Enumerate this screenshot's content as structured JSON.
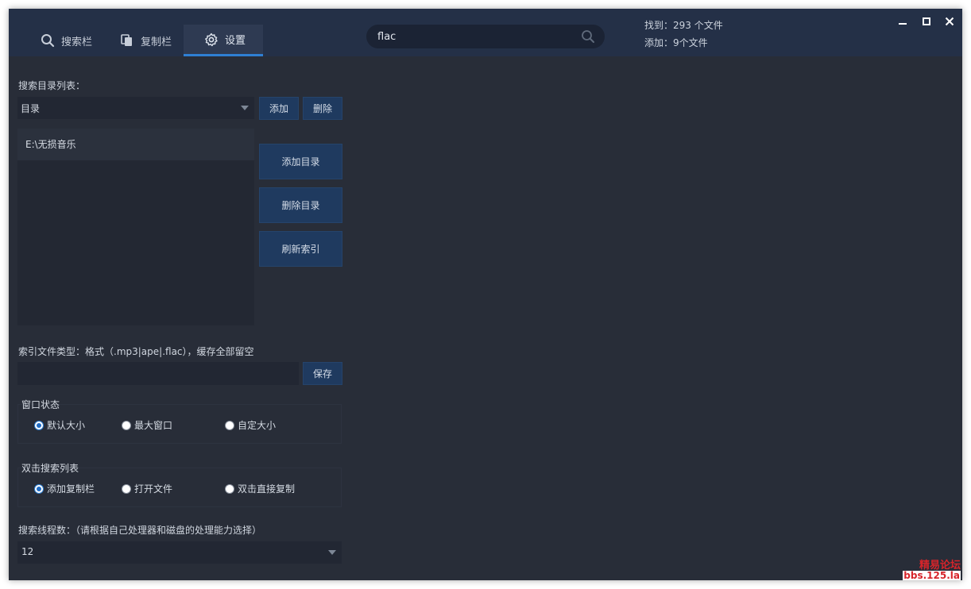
{
  "tabs": [
    {
      "label": "搜索栏",
      "icon": "search-icon"
    },
    {
      "label": "复制栏",
      "icon": "copy-icon"
    },
    {
      "label": "设置",
      "icon": "gear-icon",
      "active": true
    }
  ],
  "search": {
    "value": "flac"
  },
  "stats": {
    "found": "找到：293 个文件",
    "added": "添加：9个文件"
  },
  "window_controls": {
    "minimize": "—",
    "maximize": "▫",
    "close": "✕"
  },
  "dir_section": {
    "label": "搜索目录列表：",
    "select_value": "目录",
    "add_label": "添加",
    "delete_label": "删除",
    "items": [
      "E:\\无损音乐"
    ],
    "add_dir_label": "添加目录",
    "delete_dir_label": "删除目录",
    "refresh_label": "刷新索引"
  },
  "index_section": {
    "label": "索引文件类型：格式（.mp3|ape|.flac），缓存全部留空",
    "input_value": "",
    "save_label": "保存"
  },
  "window_state": {
    "title": "窗口状态",
    "options": [
      "默认大小",
      "最大窗口",
      "自定大小"
    ],
    "selected": 0
  },
  "double_click": {
    "title": "双击搜索列表",
    "options": [
      "添加复制栏",
      "打开文件",
      "双击直接复制"
    ],
    "selected": 0
  },
  "threads": {
    "label": "搜索线程数：（请根据自己处理器和磁盘的处理能力选择）",
    "value": "12"
  },
  "watermark": {
    "line1": "精易论坛",
    "line2": "bbs.125.la"
  },
  "colors": {
    "accent": "#2f7fd3",
    "header_bg": "#243047",
    "body_bg": "#282d38",
    "button_bg": "#1f3a5f"
  }
}
